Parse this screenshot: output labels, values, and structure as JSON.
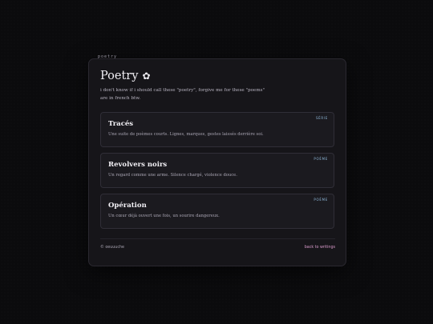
{
  "section_tab": "poetry",
  "header": {
    "title": "Poetry",
    "title_icon": "flower-icon",
    "title_icon_glyph": "✿",
    "intro": "i don't know if i should call these \"poetry\", forgive me for these \"poems\" are in french btw."
  },
  "cards": [
    {
      "title": "Tracés",
      "desc": "Une suite de poèmes courts. Lignes, marques, gestes laissés derrière soi.",
      "badge": "SÉRIE"
    },
    {
      "title": "Revolvers noirs",
      "desc": "Un regard comme une arme. Silence chargé, violence douce.",
      "badge": "POÈME"
    },
    {
      "title": "Opération",
      "desc": "Un cœur déjà ouvert une fois, un sourire dangereux.",
      "badge": "POÈME"
    }
  ],
  "footer": {
    "copyright": "© oeuuuche",
    "back_link": "back to writings"
  },
  "colors": {
    "background": "#0b0b0d",
    "panel": "#161519",
    "badge": "#8fb8d9",
    "link": "#d99acb"
  }
}
